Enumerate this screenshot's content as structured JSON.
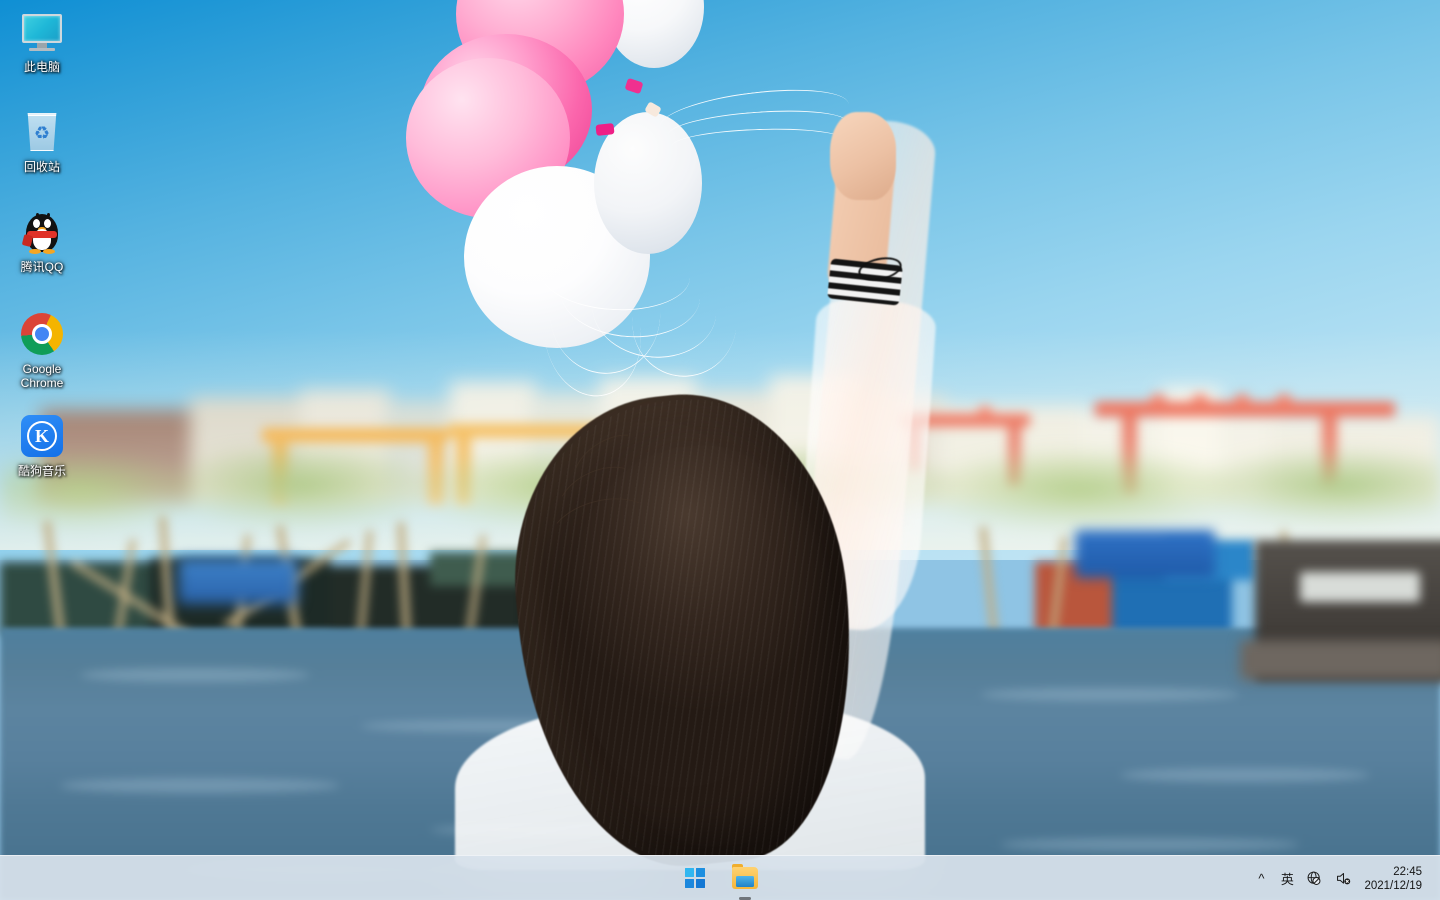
{
  "desktop": {
    "wallpaper_description": "Woman from behind with long dark hair, raised arm holding pink and white balloons, blurred harbor village and water background",
    "sky_color_top": "#0f8fd4",
    "sky_color_bottom": "#c9e7f3",
    "water_color": "#567f99",
    "icons": [
      {
        "name": "this-pc",
        "label": "此电脑",
        "icon": "monitor-icon"
      },
      {
        "name": "recycle-bin",
        "label": "回收站",
        "icon": "recycle-bin-icon"
      },
      {
        "name": "tencent-qq",
        "label": "腾讯QQ",
        "icon": "qq-penguin-icon"
      },
      {
        "name": "google-chrome",
        "label": "Google Chrome",
        "icon": "chrome-icon"
      },
      {
        "name": "kugou-music",
        "label": "酷狗音乐",
        "icon": "kugou-icon",
        "mark": "K"
      }
    ]
  },
  "taskbar": {
    "background_color": "#dde6ee",
    "start_button": {
      "label": "开始",
      "icon": "windows-logo-icon"
    },
    "apps": [
      {
        "name": "file-explorer",
        "label": "文件资源管理器",
        "icon": "folder-icon",
        "running": true
      }
    ],
    "tray": {
      "overflow": {
        "label": "^",
        "icon": "chevron-up-icon"
      },
      "ime": {
        "label": "英",
        "icon": "ime-icon"
      },
      "network": {
        "label": "",
        "icon": "globe-no-internet-icon",
        "status": "无 Internet 访问权限"
      },
      "volume": {
        "label": "",
        "icon": "speaker-muted-icon",
        "status": "已静音"
      }
    },
    "clock": {
      "time": "22:45",
      "date": "2021/12/19"
    }
  }
}
